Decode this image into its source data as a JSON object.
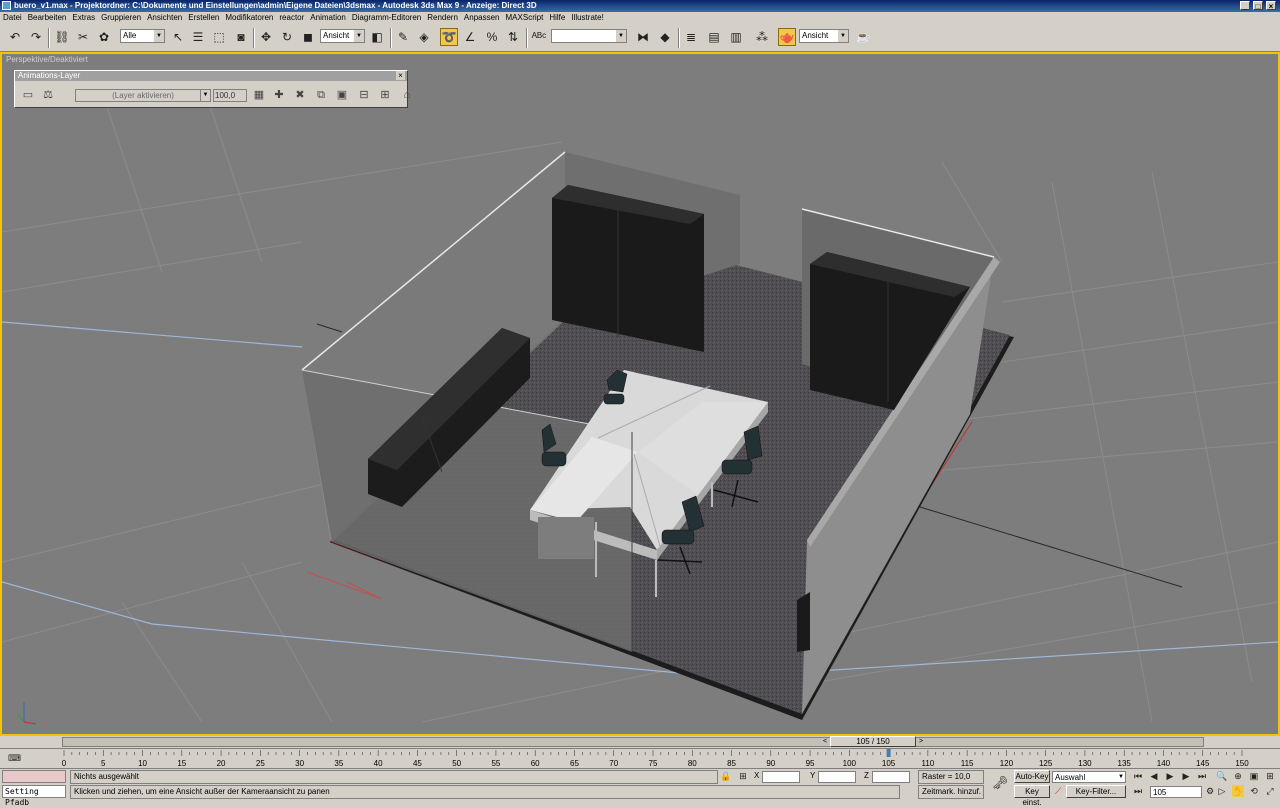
{
  "window": {
    "title": "buero_v1.max   - Projektordner: C:\\Dokumente und Einstellungen\\admin\\Eigene Dateien\\3dsmax   -   Autodesk 3ds Max 9   - Anzeige: Direct 3D",
    "minimize": "_",
    "maximize": "□",
    "close": "×"
  },
  "menu": [
    "Datei",
    "Bearbeiten",
    "Extras",
    "Gruppieren",
    "Ansichten",
    "Erstellen",
    "Modifikatoren",
    "reactor",
    "Animation",
    "Diagramm-Editoren",
    "Rendern",
    "Anpassen",
    "MAXScript",
    "Hilfe",
    "Illustrate!"
  ],
  "toolbar": {
    "selection_filter": "Alle",
    "ref_coord": "Ansicht",
    "named_selection": "",
    "render_view": "Ansicht",
    "icons": [
      "undo-icon",
      "redo-icon",
      "link-icon",
      "unlink-icon",
      "bind-space-warp-icon",
      "select-icon",
      "select-by-name-icon",
      "rect-region-icon",
      "window-crossing-icon",
      "move-icon",
      "rotate-icon",
      "scale-icon",
      "mirror-icon",
      "align-icon",
      "snap-icon",
      "angle-snap-icon",
      "percent-snap-icon",
      "spinner-snap-icon",
      "edit-named-sel-icon",
      "mirror-tool-icon",
      "align-tool-icon",
      "layer-manager-icon",
      "curve-editor-icon",
      "schematic-view-icon",
      "material-editor-icon",
      "render-scene-icon",
      "quick-render-icon"
    ]
  },
  "viewport": {
    "label": "Perspektive/Deaktiviert",
    "active_border_color": "#f5c400"
  },
  "anim_layer_panel": {
    "title": "Animations-Layer",
    "close": "×",
    "layer_dropdown": "(Layer aktivieren)",
    "weight_value": "100,0"
  },
  "timeslider": {
    "frame_label": "105 / 150",
    "prev": "<",
    "next": ">"
  },
  "ruler": {
    "ticks": [
      0,
      5,
      10,
      15,
      20,
      25,
      30,
      35,
      40,
      45,
      50,
      55,
      60,
      65,
      70,
      75,
      80,
      85,
      90,
      95,
      100,
      105,
      110,
      115,
      120,
      125,
      130,
      135,
      140,
      145,
      150
    ],
    "current_frame": 105
  },
  "status": {
    "selection_info": "Nichts ausgewählt",
    "prompt": "Klicken und ziehen, um eine Ansicht außer der Kameraansicht zu panen",
    "maxscript_listener": "Setting Pfadb",
    "x_label": "X",
    "y_label": "Y",
    "z_label": "Z",
    "x_value": "",
    "y_value": "",
    "z_value": "",
    "grid": "Raster = 10,0",
    "add_time_tag": "Zeitmark. hinzuf.",
    "auto_key": "Auto-Key",
    "set_key": "Key einst.",
    "selection_set": "Auswahl",
    "key_filter": "Key-Filter...",
    "current_frame": "105"
  }
}
